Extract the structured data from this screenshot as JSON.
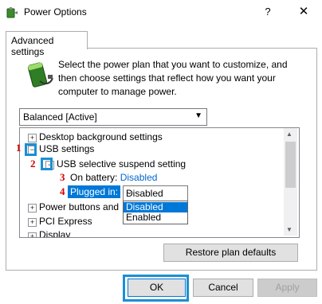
{
  "window": {
    "title": "Power Options",
    "help_glyph": "?",
    "close_glyph": "✕"
  },
  "tab": {
    "label": "Advanced settings"
  },
  "description": "Select the power plan that you want to customize, and then choose settings that reflect how you want your computer to manage power.",
  "plan_combo": {
    "value": "Balanced [Active]"
  },
  "tree": {
    "items": [
      {
        "label": "Desktop background settings",
        "expander": "+"
      },
      {
        "label": "USB settings",
        "expander": "−"
      },
      {
        "label": "USB selective suspend setting",
        "expander": "−"
      },
      {
        "label": "On battery:",
        "value": "Disabled"
      },
      {
        "label": "Plugged in:"
      },
      {
        "label": "Power buttons and",
        "expander": "+"
      },
      {
        "label": "PCI Express",
        "expander": "+"
      },
      {
        "label": "Display",
        "expander": "+"
      }
    ]
  },
  "plugged_in_select": {
    "value": "Disabled",
    "options": [
      "Disabled",
      "Enabled"
    ]
  },
  "steps": [
    "1",
    "2",
    "3",
    "4"
  ],
  "buttons": {
    "restore": "Restore plan defaults",
    "ok": "OK",
    "cancel": "Cancel",
    "apply": "Apply"
  },
  "colors": {
    "accent": "#0078d7",
    "step_red": "#d40000",
    "callout_blue": "#1b8fd4"
  }
}
